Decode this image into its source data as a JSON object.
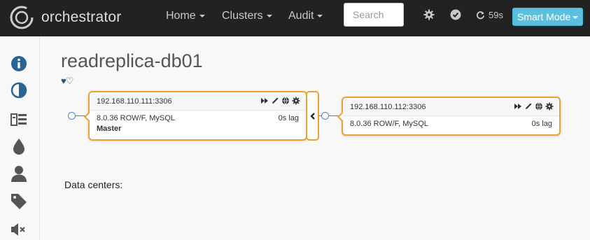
{
  "app": {
    "brand": "orchestrator"
  },
  "nav": {
    "home": "Home",
    "clusters": "Clusters",
    "audit": "Audit",
    "search_placeholder": "Search",
    "refresh_countdown": "59s",
    "smart_mode": "Smart Mode"
  },
  "sidebar": {
    "items": [
      {
        "icon": "info-icon"
      },
      {
        "icon": "contrast-icon"
      },
      {
        "icon": "list-icon"
      },
      {
        "icon": "tint-icon"
      },
      {
        "icon": "user-icon"
      },
      {
        "icon": "tag-icon"
      },
      {
        "icon": "volume-off-icon"
      }
    ]
  },
  "cluster": {
    "title": "readreplica-db01",
    "hearts": "♥♡"
  },
  "instances": [
    {
      "address": "192.168.110.111:3306",
      "version": "8.0.36 ROW/F, MySQL",
      "lag": "0s lag",
      "role": "Master"
    },
    {
      "address": "192.168.110.112:3306",
      "version": "8.0.36 ROW/F, MySQL",
      "lag": "0s lag",
      "role": ""
    }
  ],
  "data_centers_label": "Data centers:",
  "colors": {
    "navbar": "#222222",
    "accent": "#5bc0de",
    "instance_border": "#f0a030",
    "sidebar_icon": "#2a6496"
  }
}
